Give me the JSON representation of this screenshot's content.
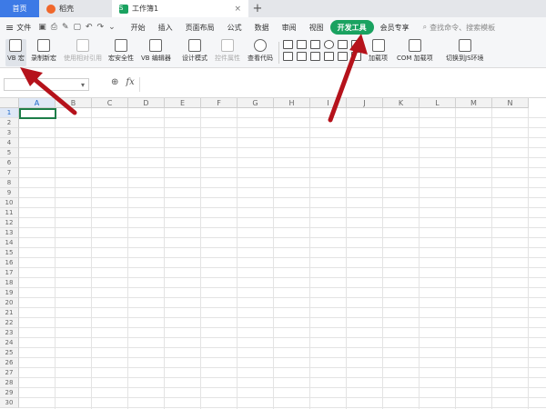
{
  "tabs": {
    "home": "首页",
    "daoke": "稻壳",
    "workbook": "工作簿1",
    "close": "×",
    "new_tab": "+"
  },
  "menu": {
    "file": "文件",
    "items": [
      "开始",
      "插入",
      "页面布局",
      "公式",
      "数据",
      "审阅",
      "视图",
      "开发工具",
      "会员专享"
    ],
    "active_index": 7,
    "search_placeholder": "查找命令、搜索模板"
  },
  "ribbon": {
    "vb_macro": "VB 宏",
    "record_macro": "录制新宏",
    "relative_ref": "使用相对引用",
    "macro_security": "宏安全性",
    "vb_editor": "VB 编辑器",
    "design_mode": "设计模式",
    "control_props": "控件属性",
    "view_code": "查看代码",
    "addins": "加载项",
    "com_addins": "COM 加载项",
    "switch_js": "切换到JS环境"
  },
  "formula_bar": {
    "name_box": "",
    "fx_label": "fx",
    "zoom_icon": "zoom-icon"
  },
  "grid": {
    "columns": [
      "A",
      "B",
      "C",
      "D",
      "E",
      "F",
      "G",
      "H",
      "I",
      "J",
      "K",
      "L",
      "M",
      "N"
    ],
    "rows": [
      "1",
      "2",
      "3",
      "4",
      "5",
      "6",
      "7",
      "8",
      "9",
      "10",
      "11",
      "12",
      "13",
      "14",
      "15",
      "16",
      "17",
      "18",
      "19",
      "20",
      "21",
      "22",
      "23",
      "24",
      "25",
      "26",
      "27",
      "28",
      "29",
      "30"
    ],
    "selected_cell": "A1"
  },
  "colors": {
    "accent_green": "#1aa260",
    "home_tab_blue": "#3d7ae6",
    "annotation_red": "#b5121b"
  }
}
